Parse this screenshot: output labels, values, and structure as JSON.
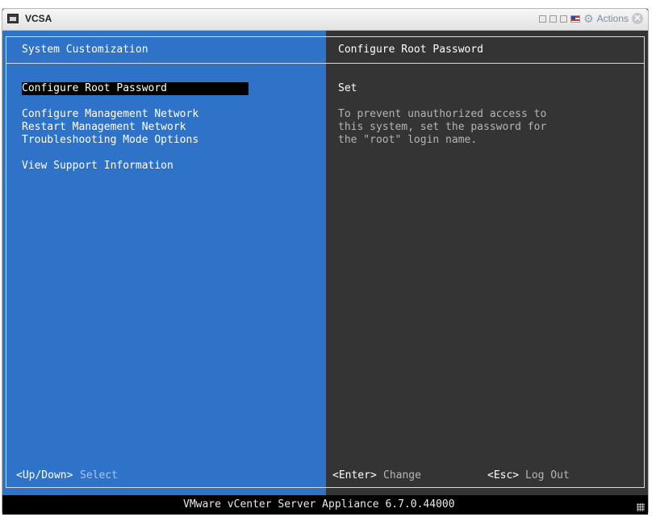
{
  "window": {
    "title": "VCSA",
    "actions_label": "Actions",
    "icons": [
      "console-icon",
      "send-keys-icon",
      "fullscreen-icon",
      "window-icon",
      "keyboard-flag-icon",
      "gear-icon",
      "close-icon"
    ]
  },
  "left_panel": {
    "header": "System Customization",
    "menu": [
      {
        "label": "Configure Root Password",
        "selected": true
      },
      {
        "label": "Configure Management Network",
        "selected": false
      },
      {
        "label": "Restart Management Network",
        "selected": false
      },
      {
        "label": "Troubleshooting Mode Options",
        "selected": false
      },
      {
        "label": "View Support Information",
        "selected": false
      }
    ],
    "footer_key": "<Up/Down>",
    "footer_action": "Select"
  },
  "right_panel": {
    "header": "Configure Root Password",
    "status": "Set",
    "description": [
      "To prevent unauthorized access to",
      "this system, set the password for",
      "the \"root\" login name."
    ],
    "enter_key": "<Enter>",
    "enter_action": "Change",
    "esc_key": "<Esc>",
    "esc_action": "Log Out"
  },
  "status_bar": {
    "text": "VMware vCenter Server Appliance 6.7.0.44000"
  },
  "colors": {
    "left_bg": "#2f73c9",
    "right_bg": "#343434",
    "selected_bg": "#000000"
  }
}
